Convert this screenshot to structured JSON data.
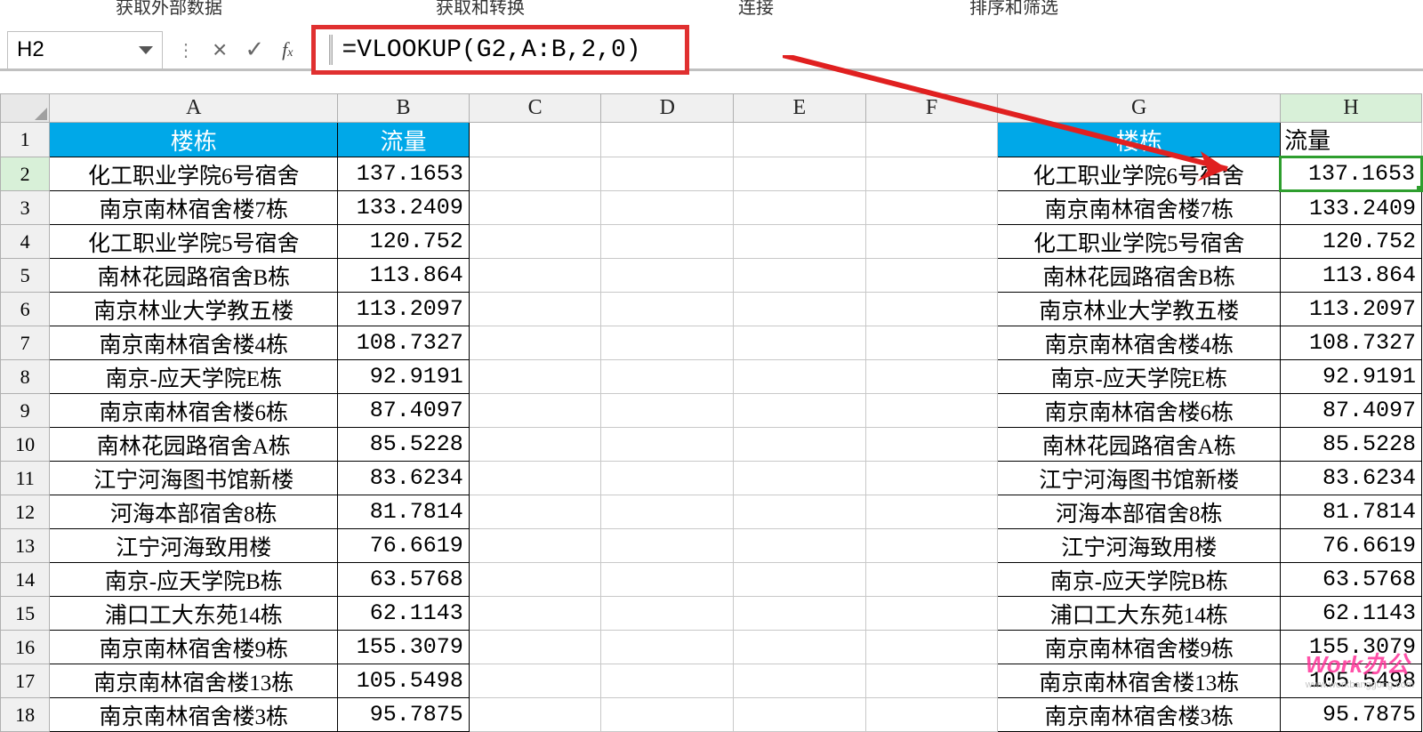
{
  "top_labels": {
    "a": "获取外部数据",
    "b": "获取和转换",
    "c": "连接",
    "d": "排序和筛选"
  },
  "name_box": "H2",
  "formula": "=VLOOKUP(G2,A:B,2,0)",
  "col_heads": [
    "A",
    "B",
    "C",
    "D",
    "E",
    "F",
    "G",
    "H"
  ],
  "headers": {
    "building": "楼栋",
    "flow": "流量"
  },
  "rows": [
    {
      "a": "化工职业学院6号宿舍",
      "b": "137.1653",
      "g": "化工职业学院6号宿舍",
      "h": "137.1653"
    },
    {
      "a": "南京南林宿舍楼7栋",
      "b": "133.2409",
      "g": "南京南林宿舍楼7栋",
      "h": "133.2409"
    },
    {
      "a": "化工职业学院5号宿舍",
      "b": "120.752",
      "g": "化工职业学院5号宿舍",
      "h": "120.752"
    },
    {
      "a": "南林花园路宿舍B栋",
      "b": "113.864",
      "g": "南林花园路宿舍B栋",
      "h": "113.864"
    },
    {
      "a": "南京林业大学教五楼",
      "b": "113.2097",
      "g": "南京林业大学教五楼",
      "h": "113.2097"
    },
    {
      "a": "南京南林宿舍楼4栋",
      "b": "108.7327",
      "g": "南京南林宿舍楼4栋",
      "h": "108.7327"
    },
    {
      "a": "南京-应天学院E栋",
      "b": "92.9191",
      "g": "南京-应天学院E栋",
      "h": "92.9191"
    },
    {
      "a": "南京南林宿舍楼6栋",
      "b": "87.4097",
      "g": "南京南林宿舍楼6栋",
      "h": "87.4097"
    },
    {
      "a": "南林花园路宿舍A栋",
      "b": "85.5228",
      "g": "南林花园路宿舍A栋",
      "h": "85.5228"
    },
    {
      "a": "江宁河海图书馆新楼",
      "b": "83.6234",
      "g": "江宁河海图书馆新楼",
      "h": "83.6234"
    },
    {
      "a": "河海本部宿舍8栋",
      "b": "81.7814",
      "g": "河海本部宿舍8栋",
      "h": "81.7814"
    },
    {
      "a": "江宁河海致用楼",
      "b": "76.6619",
      "g": "江宁河海致用楼",
      "h": "76.6619"
    },
    {
      "a": "南京-应天学院B栋",
      "b": "63.5768",
      "g": "南京-应天学院B栋",
      "h": "63.5768"
    },
    {
      "a": "浦口工大东苑14栋",
      "b": "62.1143",
      "g": "浦口工大东苑14栋",
      "h": "62.1143"
    },
    {
      "a": "南京南林宿舍楼9栋",
      "b": "155.3079",
      "g": "南京南林宿舍楼9栋",
      "h": "155.3079"
    },
    {
      "a": "南京南林宿舍楼13栋",
      "b": "105.5498",
      "g": "南京南林宿舍楼13栋",
      "h": "105.5498"
    },
    {
      "a": "南京南林宿舍楼3栋",
      "b": "95.7875",
      "g": "南京南林宿舍楼3栋",
      "h": "95.7875"
    }
  ],
  "watermark": {
    "main": "Work办公",
    "sub": "www.workbanggong.com"
  }
}
